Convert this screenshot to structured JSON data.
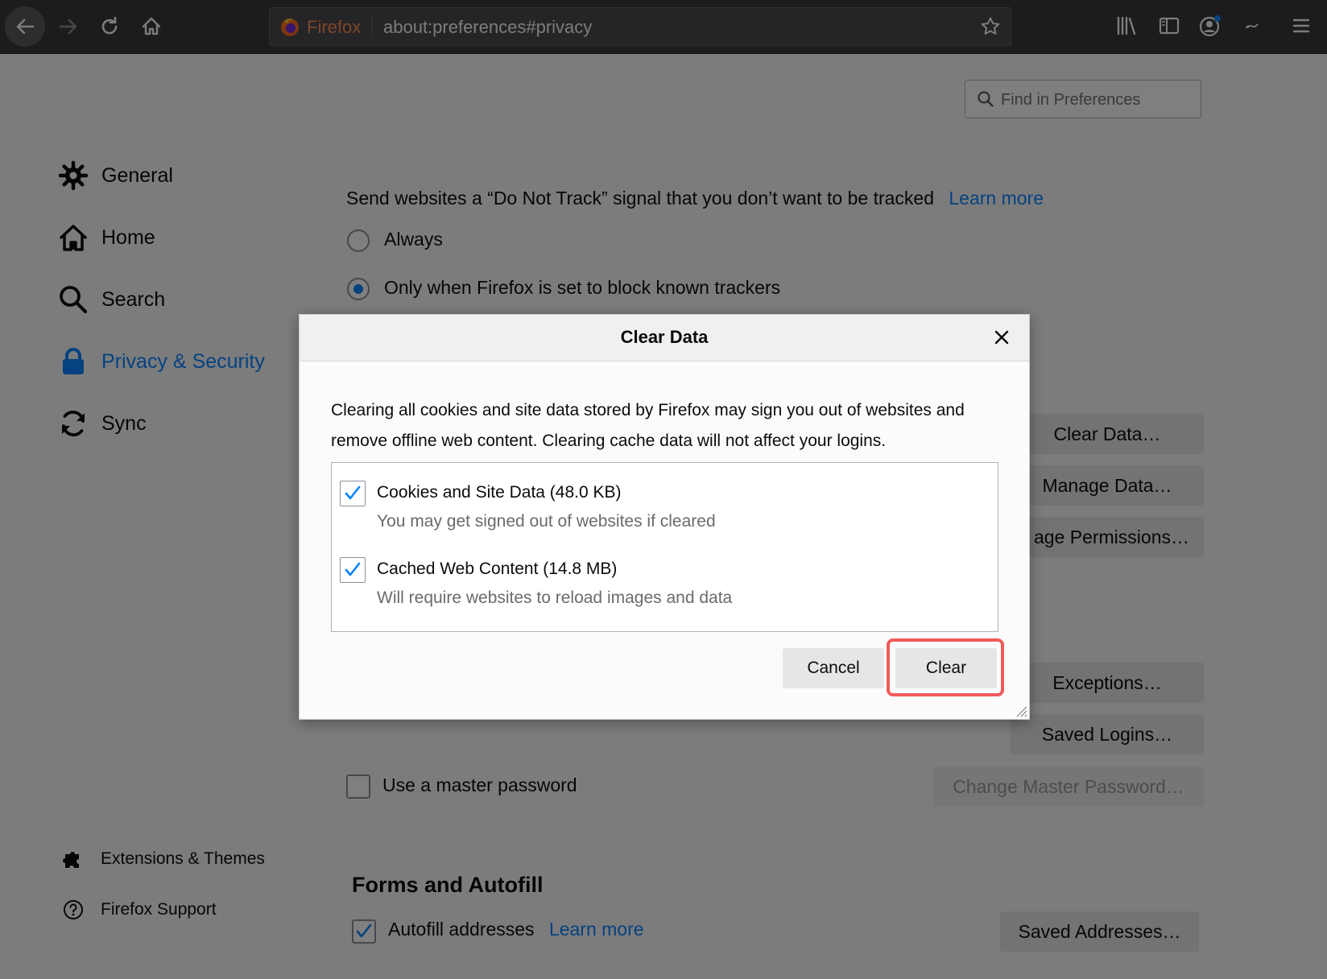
{
  "toolbar": {
    "url_brand": "Firefox",
    "url": "about:preferences#privacy",
    "icons": [
      "back-arrow-icon",
      "forward-arrow-icon",
      "reload-icon",
      "home-icon",
      "bookmark-star-icon",
      "library-icon",
      "sidebar-icon",
      "account-icon",
      "extension-icon",
      "menu-icon"
    ]
  },
  "search": {
    "placeholder": "Find in Preferences"
  },
  "sidebar": {
    "items": [
      {
        "label": "General",
        "icon": "gear-icon"
      },
      {
        "label": "Home",
        "icon": "home-icon"
      },
      {
        "label": "Search",
        "icon": "search-icon"
      },
      {
        "label": "Privacy & Security",
        "icon": "lock-icon",
        "active": true
      },
      {
        "label": "Sync",
        "icon": "sync-icon"
      }
    ],
    "footer": [
      {
        "label": "Extensions & Themes",
        "icon": "puzzle-icon"
      },
      {
        "label": "Firefox Support",
        "icon": "help-icon"
      }
    ]
  },
  "dnt": {
    "text": "Send websites a “Do Not Track” signal that you don’t want to be tracked",
    "learn_more": "Learn more",
    "options": [
      "Always",
      "Only when Firefox is set to block known trackers"
    ],
    "selected": "Only when Firefox is set to block known trackers"
  },
  "right_buttons": {
    "clear_data": "Clear Data…",
    "manage_data": "Manage Data…",
    "manage_permissions": "age Permissions…",
    "exceptions": "Exceptions…",
    "saved_logins": "Saved Logins…",
    "change_master": "Change Master Password…"
  },
  "master_password": {
    "label": "Use a master password",
    "checked": false
  },
  "forms": {
    "title": "Forms and Autofill",
    "autofill_label": "Autofill addresses",
    "learn_more": "Learn more",
    "saved_addresses": "Saved Addresses…",
    "checked": true
  },
  "dialog": {
    "title": "Clear Data",
    "description": "Clearing all cookies and site data stored by Firefox may sign you out of websites and remove offline web content. Clearing cache data will not affect your logins.",
    "options": [
      {
        "label": "Cookies and Site Data (48.0 KB)",
        "sub": "You may get signed out of websites if cleared",
        "checked": true
      },
      {
        "label": "Cached Web Content (14.8 MB)",
        "sub": "Will require websites to reload images and data",
        "checked": true
      }
    ],
    "cancel": "Cancel",
    "clear": "Clear"
  },
  "colors": {
    "accent": "#0a84ff",
    "highlight": "#f05a5a",
    "toolbar": "#38383d"
  }
}
